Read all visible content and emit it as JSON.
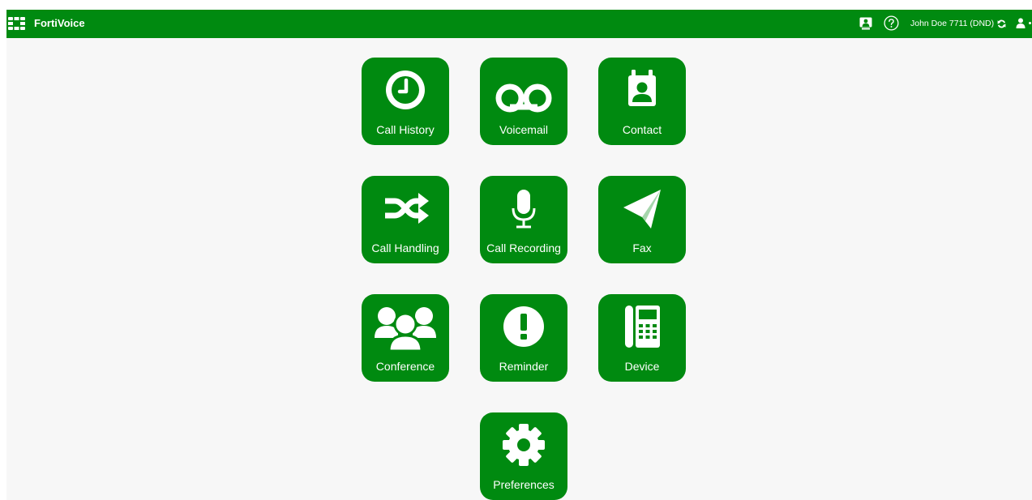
{
  "app": {
    "brand": "FortiVoice",
    "user_label": "John Doe 7711 (DND)"
  },
  "colors": {
    "brand_green": "#008a10",
    "background": "#f7f7f7",
    "text_on_green": "#ffffff"
  },
  "header_icons": [
    "fortinet-logo-icon",
    "presence-icon",
    "help-icon",
    "refresh-icon",
    "user-icon"
  ],
  "tiles": [
    {
      "label": "Call History",
      "icon": "clock-icon"
    },
    {
      "label": "Voicemail",
      "icon": "voicemail-icon"
    },
    {
      "label": "Contact",
      "icon": "contact-card-icon"
    },
    {
      "label": "Call Handling",
      "icon": "shuffle-icon"
    },
    {
      "label": "Call Recording",
      "icon": "microphone-icon"
    },
    {
      "label": "Fax",
      "icon": "paper-plane-icon"
    },
    {
      "label": "Conference",
      "icon": "users-icon"
    },
    {
      "label": "Reminder",
      "icon": "exclamation-icon"
    },
    {
      "label": "Device",
      "icon": "desk-phone-icon"
    },
    {
      "label": "Preferences",
      "icon": "gear-icon"
    }
  ]
}
